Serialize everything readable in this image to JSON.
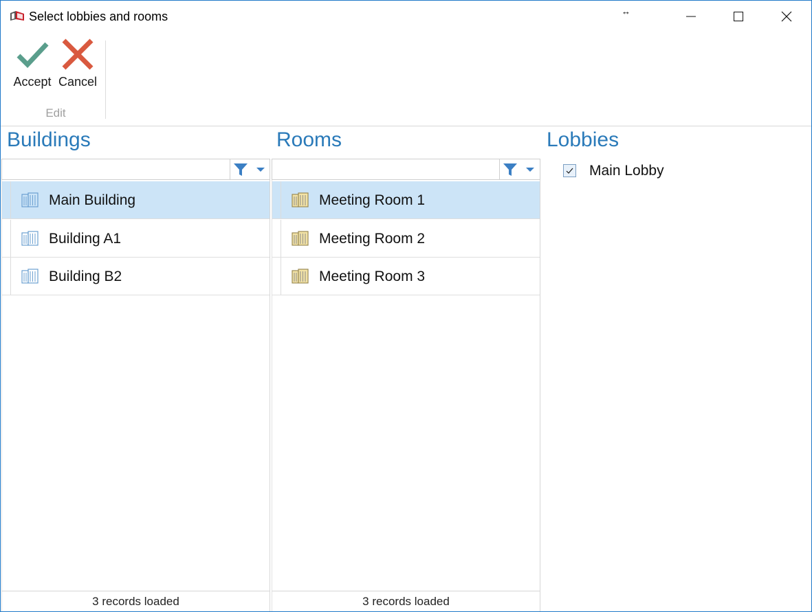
{
  "window": {
    "title": "Select lobbies and rooms",
    "resize_hint": "↔"
  },
  "ribbon": {
    "accept_label": "Accept",
    "cancel_label": "Cancel",
    "group_label": "Edit"
  },
  "buildings": {
    "title": "Buildings",
    "filter_value": "",
    "items": [
      {
        "label": "Main Building",
        "selected": true
      },
      {
        "label": "Building A1",
        "selected": false
      },
      {
        "label": "Building B2",
        "selected": false
      }
    ],
    "status": "3 records loaded"
  },
  "rooms": {
    "title": "Rooms",
    "filter_value": "",
    "items": [
      {
        "label": "Meeting Room 1",
        "selected": true
      },
      {
        "label": "Meeting Room 2",
        "selected": false
      },
      {
        "label": "Meeting Room 3",
        "selected": false
      }
    ],
    "status": "3 records loaded"
  },
  "lobbies": {
    "title": "Lobbies",
    "items": [
      {
        "label": "Main Lobby",
        "checked": true
      }
    ]
  },
  "colors": {
    "accent_blue": "#2a7ab9",
    "selection": "#cce4f7",
    "accept_green": "#5a9e8c",
    "cancel_red": "#d9593f",
    "window_border": "#1e78c8"
  },
  "icons": {
    "app": "app-logo-icon",
    "accept": "checkmark-icon",
    "cancel": "x-icon",
    "filter": "funnel-icon",
    "dropdown": "chevron-down-icon",
    "building": "building-icon",
    "room": "room-building-icon"
  }
}
